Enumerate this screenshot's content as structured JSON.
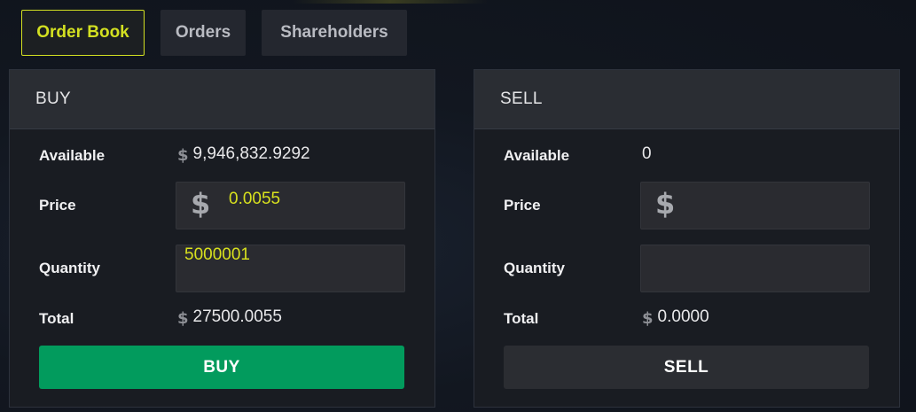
{
  "tabs": [
    {
      "label": "Order Book",
      "active": true
    },
    {
      "label": "Orders",
      "active": false
    },
    {
      "label": "Shareholders",
      "active": false
    }
  ],
  "currency_icon": "dollar-coin-icon",
  "colors": {
    "accent": "#d3e021",
    "buy_button": "#029b5d",
    "sell_button": "#2b2d32",
    "panel_header": "#2a2d33"
  },
  "buy": {
    "title": "BUY",
    "available_label": "Available",
    "available_value": "9,946,832.9292",
    "price_label": "Price",
    "price_value": "0.0055",
    "quantity_label": "Quantity",
    "quantity_value": "5000001",
    "total_label": "Total",
    "total_value": "27500.0055",
    "button_label": "BUY"
  },
  "sell": {
    "title": "SELL",
    "available_label": "Available",
    "available_value": "0",
    "price_label": "Price",
    "price_value": "",
    "quantity_label": "Quantity",
    "quantity_value": "",
    "total_label": "Total",
    "total_value": "0.0000",
    "button_label": "SELL"
  }
}
